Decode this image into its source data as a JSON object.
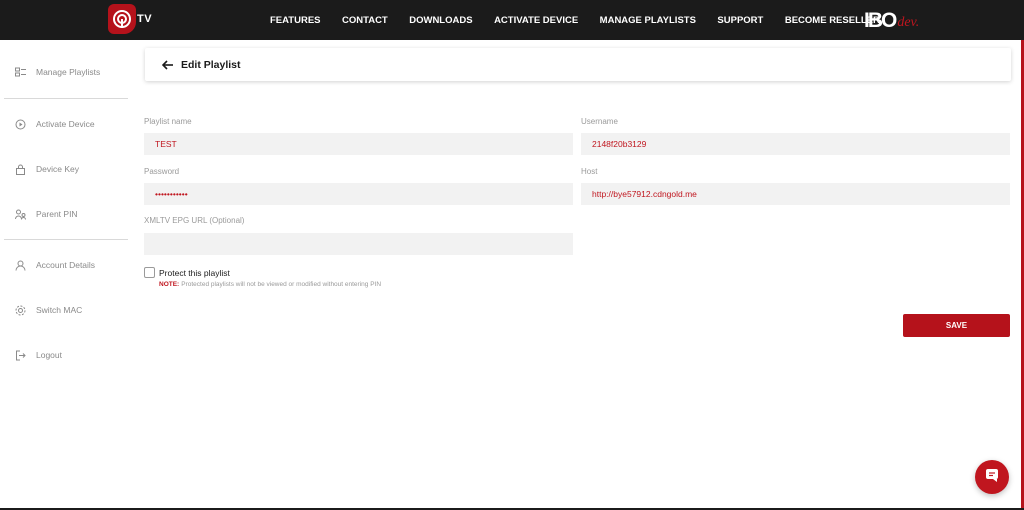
{
  "brand": {
    "logo_text": "TV",
    "right_logo_main": "IBO",
    "right_logo_sub": "dev."
  },
  "nav": {
    "links": [
      {
        "label": "FEATURES"
      },
      {
        "label": "CONTACT"
      },
      {
        "label": "DOWNLOADS"
      },
      {
        "label": "ACTIVATE DEVICE"
      },
      {
        "label": "MANAGE PLAYLISTS"
      },
      {
        "label": "SUPPORT"
      },
      {
        "label": "BECOME RESELLER"
      }
    ]
  },
  "sidebar": {
    "items": [
      {
        "label": "Manage Playlists",
        "icon": "playlist-icon"
      },
      {
        "label": "Activate Device",
        "icon": "activate-icon"
      },
      {
        "label": "Device Key",
        "icon": "key-icon"
      },
      {
        "label": "Parent PIN",
        "icon": "parental-icon"
      },
      {
        "label": "Account Details",
        "icon": "user-icon"
      },
      {
        "label": "Switch MAC",
        "icon": "gear-icon"
      },
      {
        "label": "Logout",
        "icon": "logout-icon"
      }
    ]
  },
  "header": {
    "title": "Edit Playlist"
  },
  "form": {
    "playlist_name": {
      "label": "Playlist name",
      "value": "TEST"
    },
    "username": {
      "label": "Username",
      "value": "2148f20b3129"
    },
    "password": {
      "label": "Password",
      "value": "•••••••••••"
    },
    "host": {
      "label": "Host",
      "value": "http://bye57912.cdngold.me"
    },
    "epg": {
      "label": "XMLTV EPG URL (Optional)",
      "value": ""
    },
    "protect": {
      "label": "Protect this playlist",
      "checked": false
    },
    "note": {
      "tag": "NOTE:",
      "text": "Protected playlists will not be viewed or modified without entering PIN"
    },
    "save_label": "SAVE"
  },
  "colors": {
    "accent": "#b5121b",
    "nav_bg": "#1b1b1b",
    "input_bg": "#f2f2f2"
  }
}
